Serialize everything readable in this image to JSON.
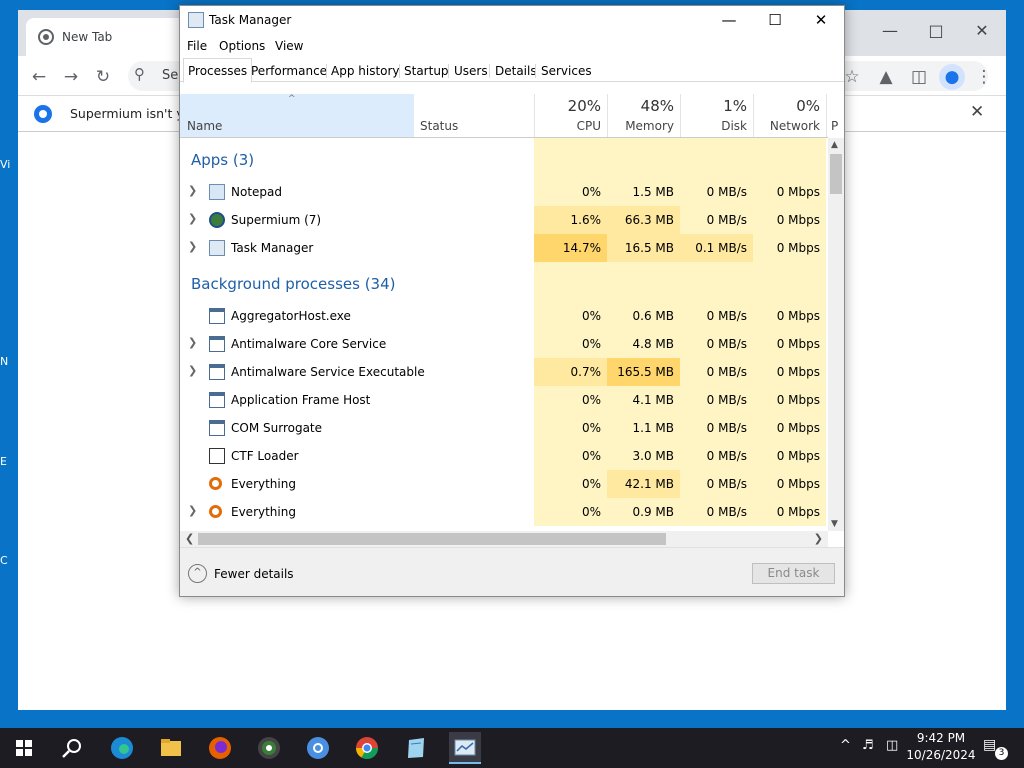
{
  "browser": {
    "tab_label": "New Tab",
    "omnibox_text": "Sea",
    "infobar_text": "Supermium isn't yo"
  },
  "desktop_icon_letters": [
    "Vi",
    "N",
    "E",
    "C"
  ],
  "task_manager": {
    "title": "Task Manager",
    "menu": [
      "File",
      "Options",
      "View"
    ],
    "tabs": [
      "Processes",
      "Performance",
      "App history",
      "Startup",
      "Users",
      "Details",
      "Services"
    ],
    "active_tab": "Processes",
    "columns": {
      "name": "Name",
      "status": "Status",
      "cpu": {
        "pct": "20%",
        "label": "CPU"
      },
      "memory": {
        "pct": "48%",
        "label": "Memory"
      },
      "disk": {
        "pct": "1%",
        "label": "Disk"
      },
      "network": {
        "pct": "0%",
        "label": "Network"
      },
      "power": "P"
    },
    "groups": {
      "apps": "Apps (3)",
      "background": "Background processes (34)"
    },
    "apps": [
      {
        "name": "Notepad",
        "cpu": "0%",
        "memory": "1.5 MB",
        "disk": "0 MB/s",
        "network": "0 Mbps"
      },
      {
        "name": "Supermium (7)",
        "cpu": "1.6%",
        "memory": "66.3 MB",
        "disk": "0 MB/s",
        "network": "0 Mbps"
      },
      {
        "name": "Task Manager",
        "cpu": "14.7%",
        "memory": "16.5 MB",
        "disk": "0.1 MB/s",
        "network": "0 Mbps"
      }
    ],
    "background": [
      {
        "name": "AggregatorHost.exe",
        "cpu": "0%",
        "memory": "0.6 MB",
        "disk": "0 MB/s",
        "network": "0 Mbps"
      },
      {
        "name": "Antimalware Core Service",
        "cpu": "0%",
        "memory": "4.8 MB",
        "disk": "0 MB/s",
        "network": "0 Mbps"
      },
      {
        "name": "Antimalware Service Executable",
        "cpu": "0.7%",
        "memory": "165.5 MB",
        "disk": "0 MB/s",
        "network": "0 Mbps"
      },
      {
        "name": "Application Frame Host",
        "cpu": "0%",
        "memory": "4.1 MB",
        "disk": "0 MB/s",
        "network": "0 Mbps"
      },
      {
        "name": "COM Surrogate",
        "cpu": "0%",
        "memory": "1.1 MB",
        "disk": "0 MB/s",
        "network": "0 Mbps"
      },
      {
        "name": "CTF Loader",
        "cpu": "0%",
        "memory": "3.0 MB",
        "disk": "0 MB/s",
        "network": "0 Mbps"
      },
      {
        "name": "Everything",
        "cpu": "0%",
        "memory": "42.1 MB",
        "disk": "0 MB/s",
        "network": "0 Mbps"
      },
      {
        "name": "Everything",
        "cpu": "0%",
        "memory": "0.9 MB",
        "disk": "0 MB/s",
        "network": "0 Mbps"
      }
    ],
    "footer": {
      "fewer_details": "Fewer details",
      "end_task": "End task"
    }
  },
  "taskbar": {
    "time": "9:42 PM",
    "date": "10/26/2024",
    "notification_count": "3"
  },
  "colors": {
    "desktop": "#0873c7",
    "taskbar": "#1c1c22",
    "heat_low": "#fff4c4",
    "heat_mid": "#ffe9a0",
    "heat_high": "#ffd66b",
    "group_text": "#1f5fa8"
  }
}
